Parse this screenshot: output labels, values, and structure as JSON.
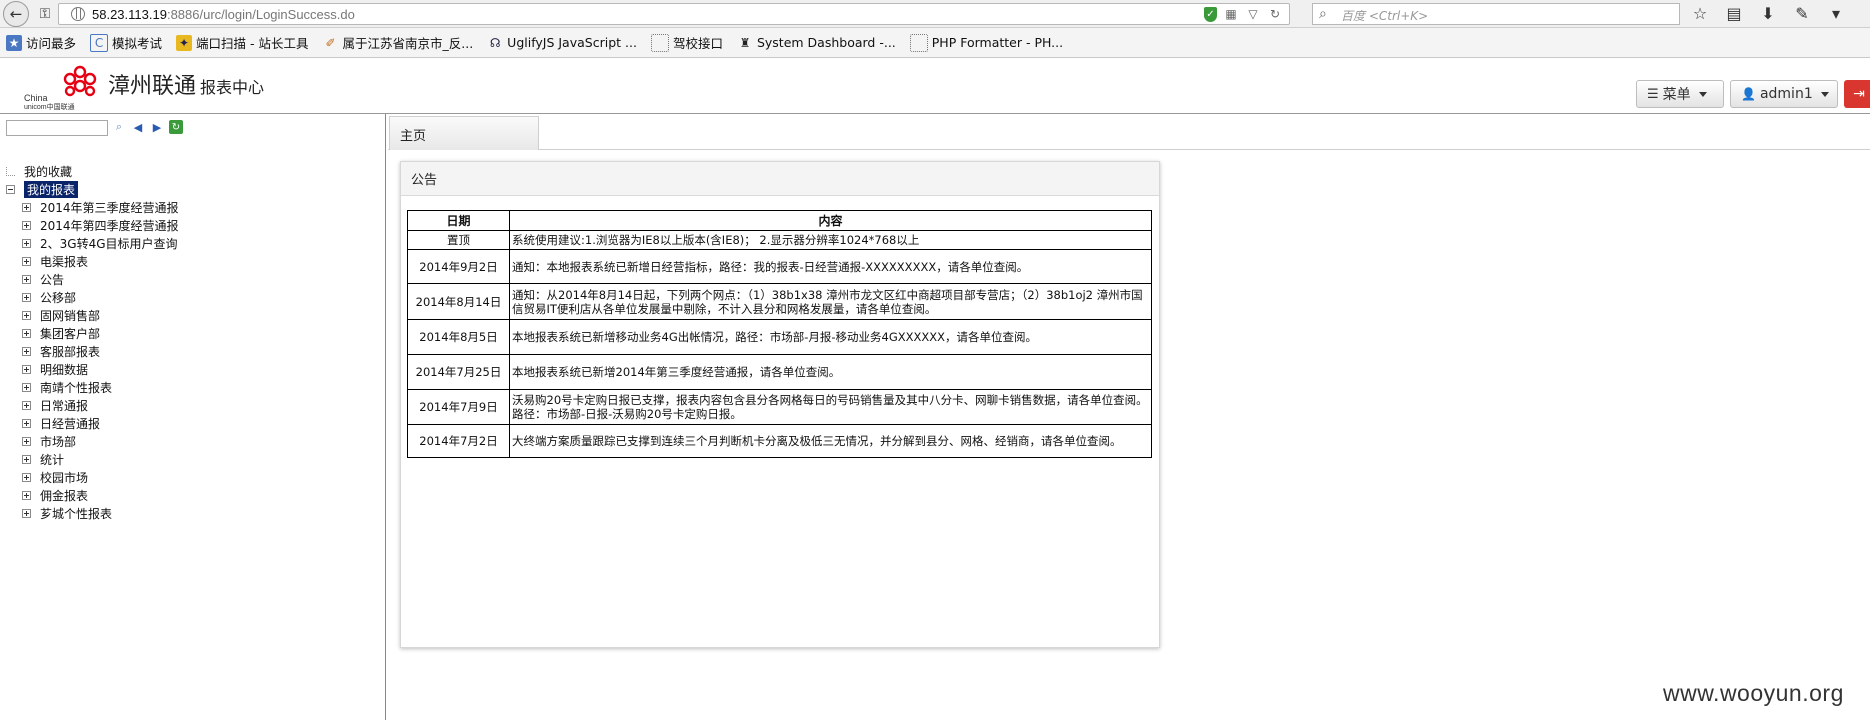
{
  "browser": {
    "url_host": "58.23.113.19",
    "url_path": ":8886/urc/login/LoginSuccess.do",
    "search_placeholder": "百度 <Ctrl+K>",
    "bookmarks": [
      {
        "label": "访问最多",
        "icon": "bookmark-star-icon"
      },
      {
        "label": "模拟考试",
        "icon": "page-icon"
      },
      {
        "label": "端口扫描 - 站长工具",
        "icon": "tool-icon"
      },
      {
        "label": "属于江苏省南京市_反...",
        "icon": "feather-icon"
      },
      {
        "label": "UglifyJS JavaScript ...",
        "icon": "js-icon"
      },
      {
        "label": "驾校接口",
        "icon": "page-icon"
      },
      {
        "label": "System Dashboard -...",
        "icon": "person-icon"
      },
      {
        "label": "PHP Formatter - PH...",
        "icon": "page-icon"
      }
    ]
  },
  "app": {
    "logo_text": "China unicom中国联通",
    "logo_line1": "China",
    "logo_line2": "unicom中国联通",
    "title": "漳州联通",
    "subtitle": "报表中心",
    "menu_label": "菜单",
    "user_label": "admin1"
  },
  "tree": {
    "favorites": "我的收藏",
    "my_reports": "我的报表",
    "items": [
      "2014年第三季度经营通报",
      "2014年第四季度经营通报",
      "2、3G转4G目标用户查询",
      "电渠报表",
      "公告",
      "公移部",
      "固网销售部",
      "集团客户部",
      "客服部报表",
      "明细数据",
      "南靖个性报表",
      "日常通报",
      "日经营通报",
      "市场部",
      "统计",
      "校园市场",
      "佣金报表",
      "芗城个性报表"
    ]
  },
  "tabs": {
    "home": "主页"
  },
  "notice": {
    "title": "公告",
    "headers": {
      "date": "日期",
      "content": "内容"
    },
    "rows": [
      {
        "date": "置顶",
        "content": "系统使用建议:1.浏览器为IE8以上版本(含IE8)； 2.显示器分辨率1024*768以上"
      },
      {
        "date": "2014年9月2日",
        "content": "通知：本地报表系统已新增日经营指标，路径：我的报表-日经营通报-XXXXXXXXX，请各单位查阅。"
      },
      {
        "date": "2014年8月14日",
        "content": "通知：从2014年8月14日起，下列两个网点：（1）38b1x38 漳州市龙文区红中商超项目部专营店；（2）38b1oj2 漳州市国信贸易IT便利店从各单位发展量中剔除，不计入县分和网格发展量，请各单位查阅。"
      },
      {
        "date": "2014年8月5日",
        "content": "本地报表系统已新增移动业务4G出帐情况，路径：市场部-月报-移动业务4GXXXXXX，请各单位查阅。"
      },
      {
        "date": "2014年7月25日",
        "content": "本地报表系统已新增2014年第三季度经营通报，请各单位查阅。"
      },
      {
        "date": "2014年7月9日",
        "content": "沃易购20号卡定购日报已支撑，报表内容包含县分各网格每日的号码销售量及其中八分卡、网聊卡销售数据，请各单位查阅。路径：市场部-日报-沃易购20号卡定购日报。"
      },
      {
        "date": "2014年7月2日",
        "content": "大终端方案质量跟踪已支撑到连续三个月判断机卡分离及极低三无情况，并分解到县分、网格、经销商，请各单位查阅。"
      }
    ]
  },
  "watermark": "www.wooyun.org",
  "colors": {
    "selected_bg": "#0a246a",
    "logout_red": "#d9362f",
    "unicom_red": "#e60012"
  }
}
